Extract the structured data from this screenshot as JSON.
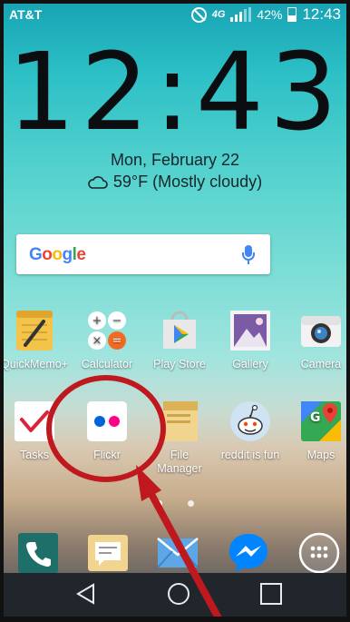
{
  "status_bar": {
    "carrier": "AT&T",
    "network": "4G",
    "battery": "42%",
    "time": "12:43"
  },
  "clock_widget": {
    "time": "12:43",
    "date": "Mon, February 22",
    "weather": "59°F (Mostly cloudy)"
  },
  "search": {
    "logo": "Google"
  },
  "apps_row1": [
    {
      "label": "QuickMemo+",
      "icon": "quickmemo-icon"
    },
    {
      "label": "Calculator",
      "icon": "calculator-icon"
    },
    {
      "label": "Play Store",
      "icon": "play-store-icon"
    },
    {
      "label": "Gallery",
      "icon": "gallery-icon"
    },
    {
      "label": "Camera",
      "icon": "camera-icon"
    }
  ],
  "apps_row2": [
    {
      "label": "Tasks",
      "icon": "tasks-icon"
    },
    {
      "label": "Flickr",
      "icon": "flickr-icon"
    },
    {
      "label": "File\nManager",
      "icon": "file-manager-icon"
    },
    {
      "label": "reddit is fun",
      "icon": "reddit-icon"
    },
    {
      "label": "Maps",
      "icon": "maps-icon"
    }
  ],
  "page_indicator": {
    "current": 1,
    "total": 2
  },
  "dock": [
    "phone-icon",
    "messaging-icon",
    "email-icon",
    "messenger-icon",
    "apps-drawer-icon"
  ],
  "nav": [
    "back-icon",
    "home-icon",
    "recents-icon"
  ],
  "annotation": {
    "color": "#c0181f"
  }
}
